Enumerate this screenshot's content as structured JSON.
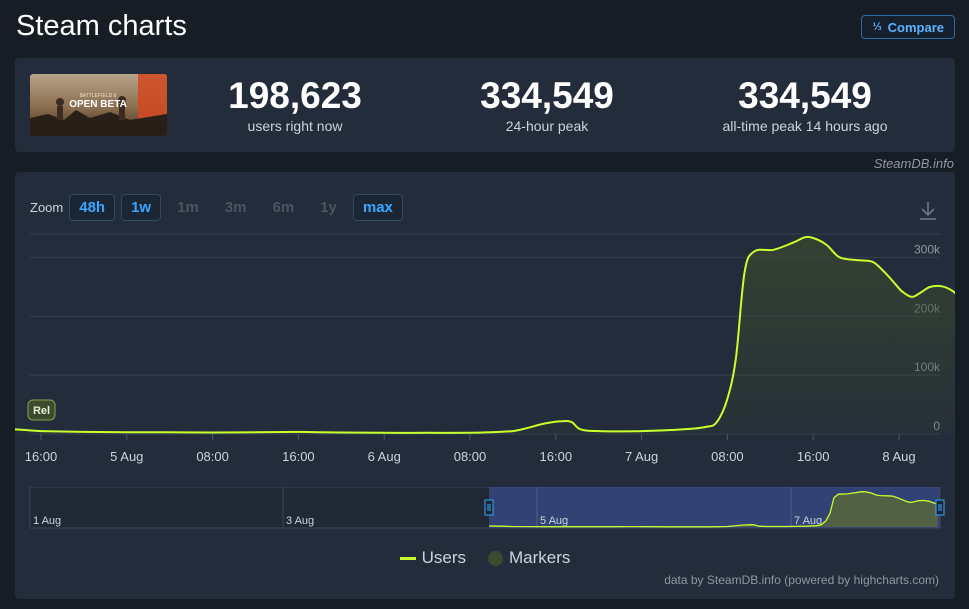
{
  "page": {
    "title": "Steam charts",
    "compare_label": "Compare",
    "compare_icon": "fraction-icon"
  },
  "game": {
    "banner_text_top": "BATTLEFIELD 6",
    "banner_text_main": "OPEN BETA"
  },
  "stats": [
    {
      "value": "198,623",
      "label": "users right now"
    },
    {
      "value": "334,549",
      "label": "24-hour peak"
    },
    {
      "value": "334,549",
      "label": "all-time peak 14 hours ago"
    }
  ],
  "credit_top": "SteamDB.info",
  "zoom": {
    "label": "Zoom",
    "options": [
      {
        "label": "48h",
        "active": true
      },
      {
        "label": "1w",
        "active": true
      },
      {
        "label": "1m",
        "active": false
      },
      {
        "label": "3m",
        "active": false
      },
      {
        "label": "6m",
        "active": false
      },
      {
        "label": "1y",
        "active": false
      },
      {
        "label": "max",
        "active": true
      }
    ]
  },
  "chart_data": {
    "type": "area",
    "title": "",
    "xlabel": "",
    "ylabel": "",
    "ylim": [
      0,
      350000
    ],
    "grid": true,
    "yticks": [
      {
        "value": 0,
        "label": "0"
      },
      {
        "value": 100000,
        "label": "100k"
      },
      {
        "value": 200000,
        "label": "200k"
      },
      {
        "value": 300000,
        "label": "300k"
      }
    ],
    "xlim": [
      -4.6,
      57.3
    ],
    "xticks": [
      {
        "h": 0,
        "label": "16:00"
      },
      {
        "h": 8,
        "label": "5 Aug"
      },
      {
        "h": 16,
        "label": "08:00"
      },
      {
        "h": 24,
        "label": "16:00"
      },
      {
        "h": 32,
        "label": "6 Aug"
      },
      {
        "h": 40,
        "label": "08:00"
      },
      {
        "h": 48,
        "label": "16:00"
      },
      {
        "h": 56,
        "label": "7 Aug"
      },
      {
        "h": 64,
        "label": "08:00"
      },
      {
        "h": 72,
        "label": "16:00"
      },
      {
        "h": 80,
        "label": "8 Aug"
      }
    ],
    "series": [
      {
        "name": "Users",
        "color": "#c8ff2d",
        "points": [
          [
            -4.6,
            9000
          ],
          [
            -2,
            7500
          ],
          [
            0,
            5000
          ],
          [
            4,
            3500
          ],
          [
            8,
            3000
          ],
          [
            12,
            3000
          ],
          [
            16,
            2500
          ],
          [
            20,
            3000
          ],
          [
            24,
            3500
          ],
          [
            28,
            2500
          ],
          [
            32,
            2000
          ],
          [
            36,
            2000
          ],
          [
            40,
            2000
          ],
          [
            42,
            3000
          ],
          [
            44,
            5000
          ],
          [
            45.3,
            10000
          ],
          [
            47,
            18000
          ],
          [
            48.7,
            22000
          ],
          [
            49.5,
            20000
          ],
          [
            50.3,
            8000
          ],
          [
            52,
            5000
          ],
          [
            56,
            5000
          ],
          [
            60,
            8000
          ],
          [
            62,
            12000
          ],
          [
            63,
            20000
          ],
          [
            64,
            60000
          ],
          [
            64.8,
            130000
          ],
          [
            65.6,
            275000
          ],
          [
            66.5,
            310000
          ],
          [
            68.3,
            313000
          ],
          [
            70.1,
            325000
          ],
          [
            71.2,
            334000
          ],
          [
            72,
            333000
          ],
          [
            73.2,
            322000
          ],
          [
            74.3,
            302000
          ],
          [
            75.2,
            297000
          ],
          [
            76.5,
            295000
          ],
          [
            77.6,
            292000
          ],
          [
            78.6,
            276000
          ],
          [
            79.5,
            258000
          ],
          [
            80.3,
            242000
          ],
          [
            81.2,
            233000
          ],
          [
            82,
            240000
          ],
          [
            82.9,
            250000
          ],
          [
            84,
            251000
          ],
          [
            85,
            243000
          ],
          [
            86,
            226000
          ],
          [
            86.8,
            212000
          ]
        ]
      }
    ],
    "markers": [
      {
        "label": "Rel"
      }
    ],
    "navigator": {
      "labels": [
        "1 Aug",
        "3 Aug",
        "5 Aug",
        "7 Aug"
      ]
    },
    "legend": [
      "Users",
      "Markers"
    ],
    "credits": "data by SteamDB.info (powered by highcharts.com)"
  }
}
